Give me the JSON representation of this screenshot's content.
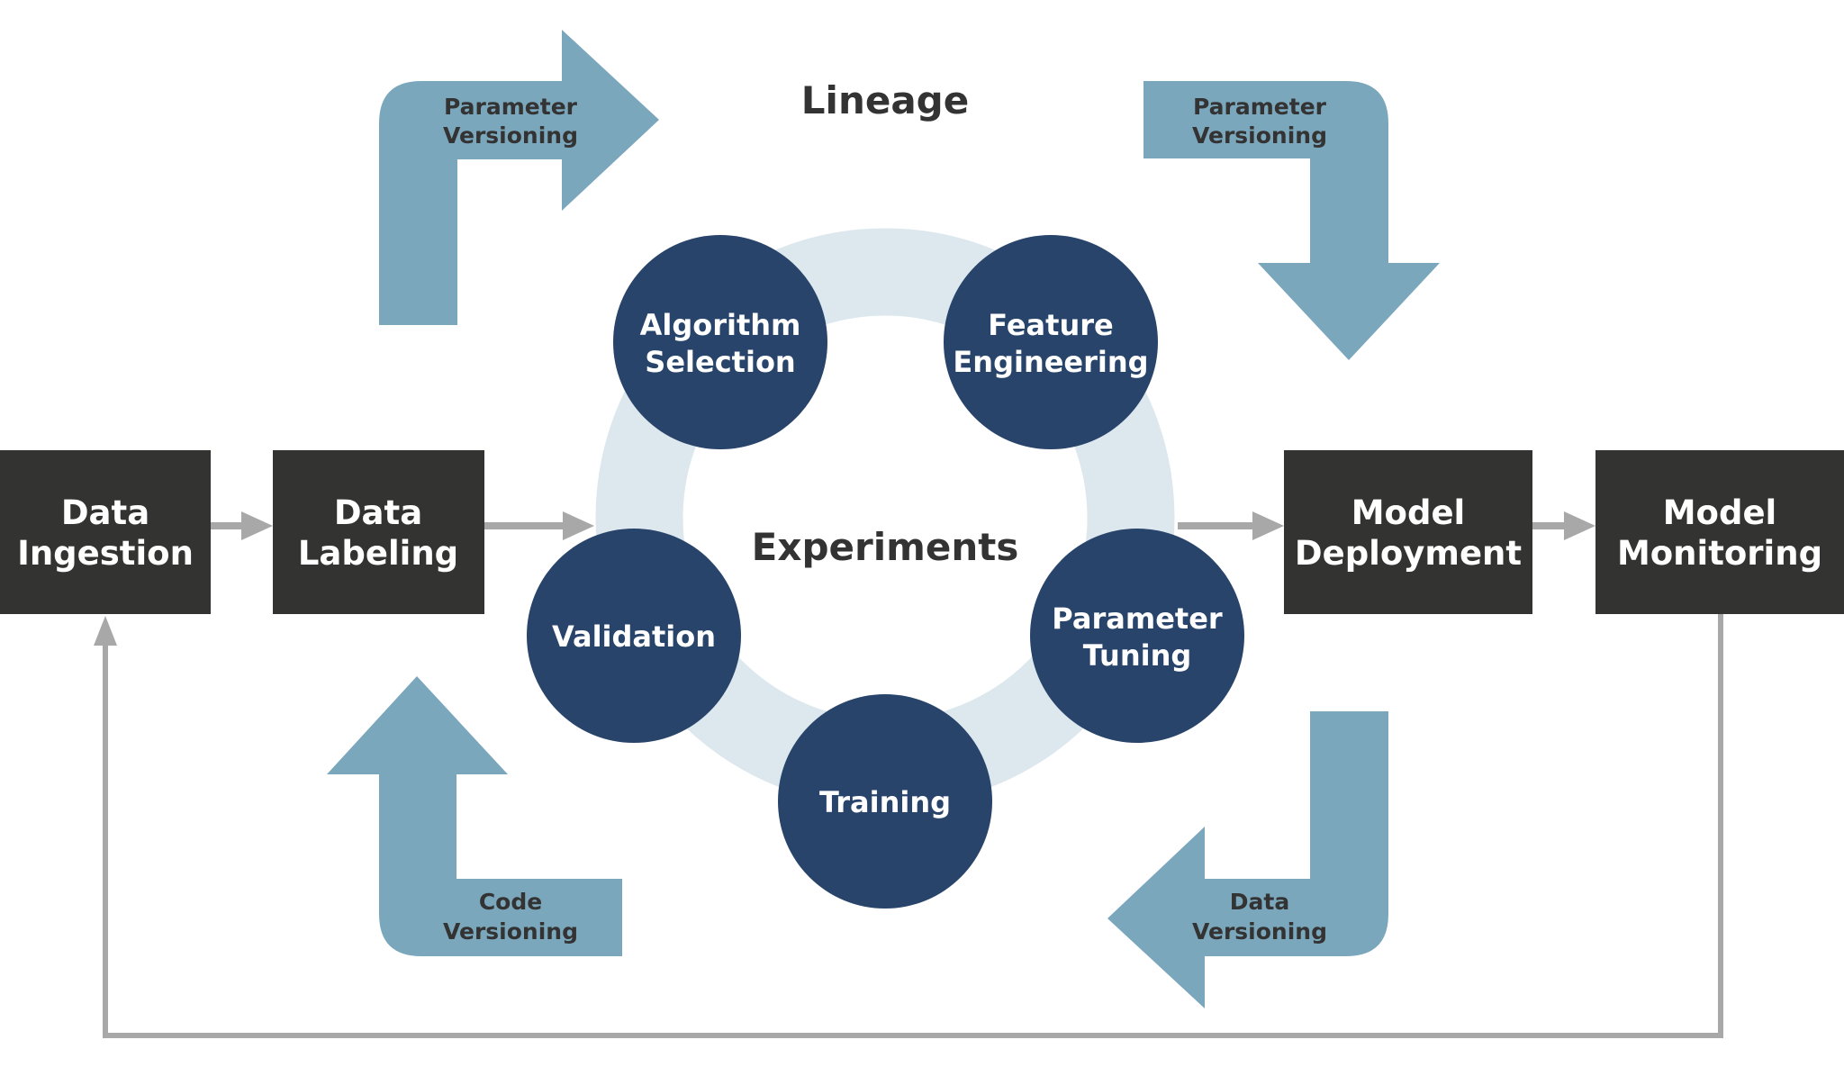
{
  "titles": {
    "lineage": "Lineage",
    "experiments": "Experiments"
  },
  "pipeline": [
    {
      "id": "ingestion",
      "lines": [
        "Data",
        "Ingestion"
      ]
    },
    {
      "id": "labeling",
      "lines": [
        "Data",
        "Labeling"
      ]
    },
    {
      "id": "deployment",
      "lines": [
        "Model",
        "Deployment"
      ]
    },
    {
      "id": "monitoring",
      "lines": [
        "Model",
        "Monitoring"
      ]
    }
  ],
  "experiment_steps": [
    {
      "id": "algorithm-selection",
      "lines": [
        "Algorithm",
        "Selection"
      ]
    },
    {
      "id": "feature-engineering",
      "lines": [
        "Feature",
        "Engineering"
      ]
    },
    {
      "id": "parameter-tuning",
      "lines": [
        "Parameter",
        "Tuning"
      ]
    },
    {
      "id": "training",
      "lines": [
        "Training"
      ]
    },
    {
      "id": "validation",
      "lines": [
        "Validation"
      ]
    }
  ],
  "versioning_arrows": [
    {
      "id": "parameter-versioning-top-left",
      "lines": [
        "Parameter",
        "Versioning"
      ],
      "direction": "right"
    },
    {
      "id": "parameter-versioning-top-right",
      "lines": [
        "Parameter",
        "Versioning"
      ],
      "direction": "down"
    },
    {
      "id": "data-versioning",
      "lines": [
        "Data",
        "Versioning"
      ],
      "direction": "left"
    },
    {
      "id": "code-versioning",
      "lines": [
        "Code",
        "Versioning"
      ],
      "direction": "up"
    }
  ],
  "colors": {
    "box": "#333331",
    "circle": "#28446b",
    "ring": "#dde8ee",
    "versioning_arrow": "#7ba7bd",
    "connector": "#a8a8a8",
    "text_dark": "#333333",
    "text_light": "#ffffff"
  }
}
